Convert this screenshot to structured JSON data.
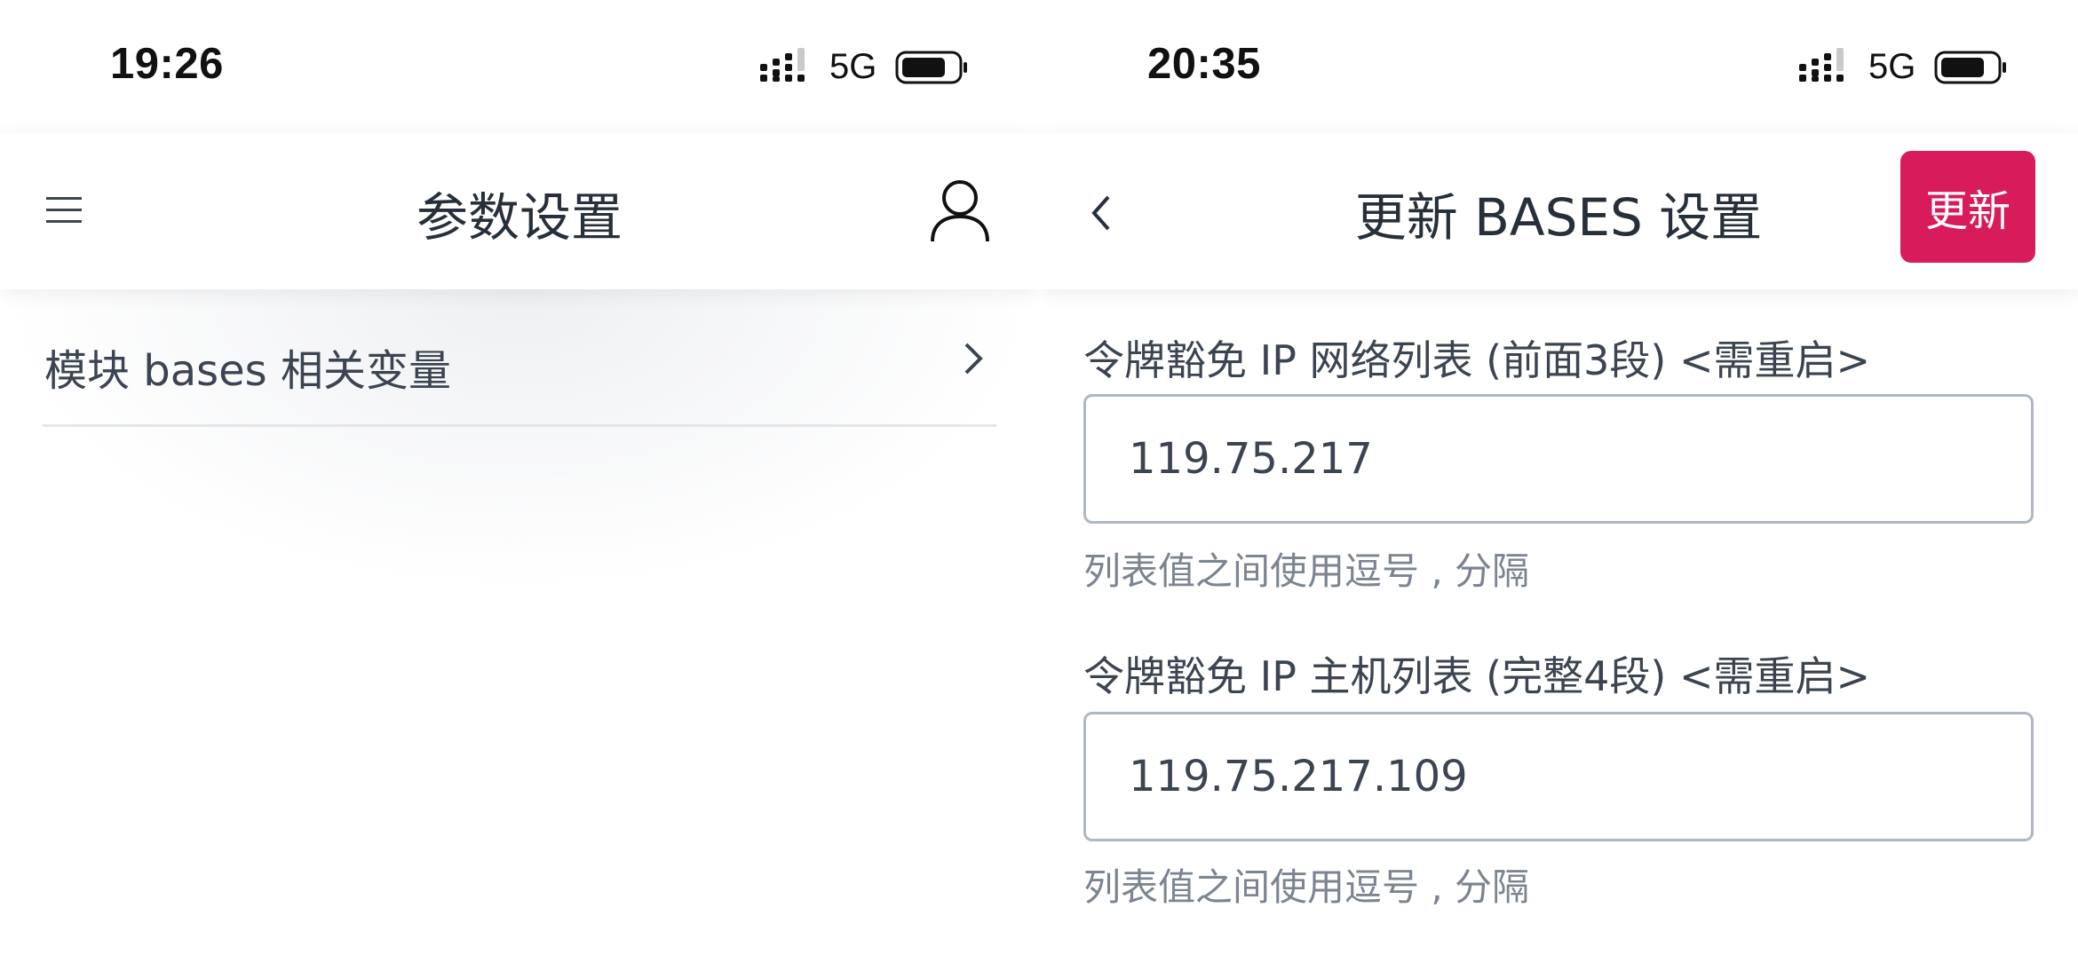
{
  "left_screen": {
    "status_bar": {
      "time": "19:26",
      "network": "5G"
    },
    "nav": {
      "title": "参数设置",
      "menu_icon": "hamburger-menu-icon",
      "user_icon": "user-profile-icon"
    },
    "list": [
      {
        "label": "模块 bases 相关变量",
        "icon": "chevron-right-icon"
      }
    ]
  },
  "right_screen": {
    "status_bar": {
      "time": "20:35",
      "network": "5G"
    },
    "nav": {
      "title": "更新 BASES 设置",
      "back_icon": "chevron-left-icon",
      "update_label": "更新"
    },
    "fields": [
      {
        "label": "令牌豁免 IP 网络列表 (前面3段) <需重启>",
        "value": "119.75.217",
        "help": "列表值之间使用逗号 , 分隔"
      },
      {
        "label": "令牌豁免 IP 主机列表 (完整4段) <需重启>",
        "value": "119.75.217.109",
        "help": "列表值之间使用逗号 , 分隔"
      }
    ]
  },
  "colors": {
    "accent": "#d81b5a",
    "text": "#2b3440",
    "muted_text": "#7b8490",
    "input_border": "#aeb7c2",
    "divider": "#e3e6ea"
  }
}
